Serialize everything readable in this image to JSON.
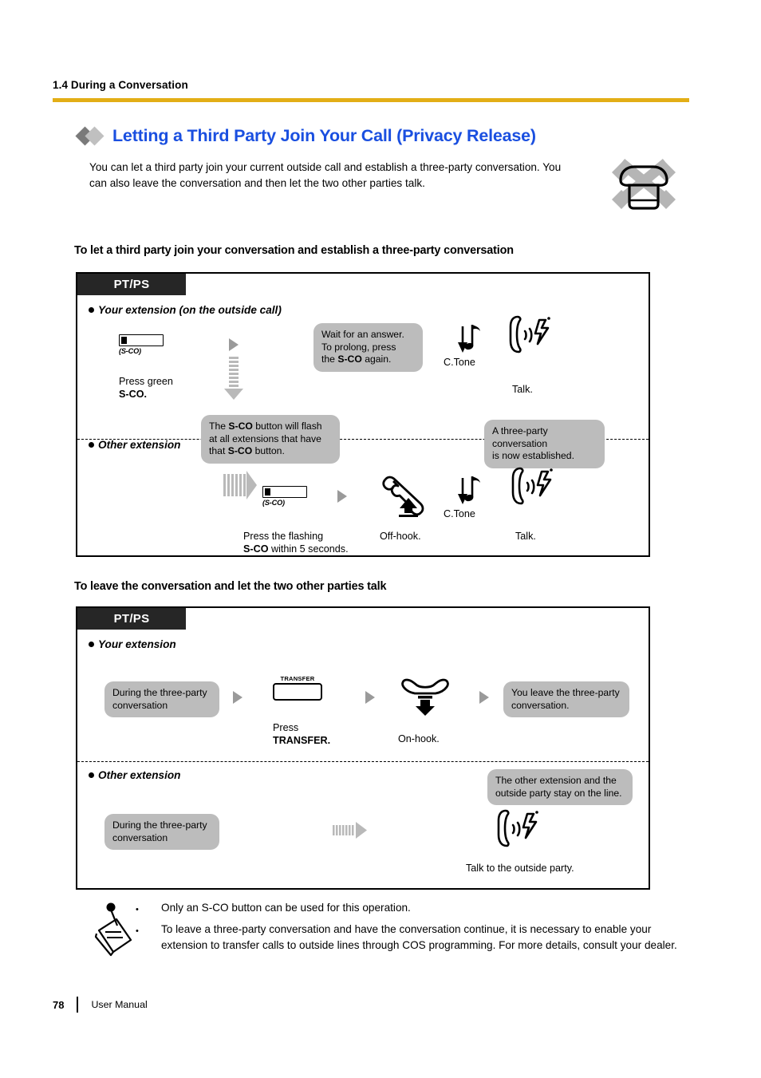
{
  "header": {
    "breadcrumb": "1.4 During a Conversation",
    "rule_color": "#e3ae16"
  },
  "title": {
    "text": "Letting a Third Party Join Your Call (Privacy Release)",
    "color": "#1a4fe0",
    "bullet_icons": [
      "diamond-dark-icon",
      "diamond-light-icon"
    ]
  },
  "intro": "You can let a third party join your current outside call and establish a three-party conversation. You can also leave the conversation and then let the two other parties talk.",
  "availability_icon": "single-line-telephone-not-available-icon",
  "section1": {
    "heading": "To let a third party join your conversation and establish a three-party conversation",
    "device_tag": "PT/PS",
    "row1": {
      "label": "Your extension (on the outside call)",
      "sco_button_label": "(S-CO)",
      "press_caption_line1": "Press green",
      "press_caption_line2": "S-CO.",
      "bubble_wait": "Wait for an answer. To prolong, press the S-CO again.",
      "bubble_wait_l1": "Wait for an answer.",
      "bubble_wait_l2": "To prolong, press",
      "bubble_wait_l3a": "the ",
      "bubble_wait_l3b": "S-CO",
      "bubble_wait_l3c": " again.",
      "ctone_label": "C.Tone",
      "talk_label": "Talk."
    },
    "bubble_flash_l1a": "The ",
    "bubble_flash_l1b": "S-CO",
    "bubble_flash_l1c": " button will flash",
    "bubble_flash_l2": "at all extensions that have",
    "bubble_flash_l3a": "that ",
    "bubble_flash_l3b": "S-CO",
    "bubble_flash_l3c": " button.",
    "bubble_established_l1": "A three-party conversation",
    "bubble_established_l2": "is now established.",
    "row2": {
      "label": "Other extension",
      "sco_button_label": "(S-CO)",
      "press_caption_line1": "Press the flashing",
      "press_caption_line2a": "S-CO",
      "press_caption_line2b": " within 5 seconds.",
      "offhook_label": "Off-hook.",
      "ctone_label": "C.Tone",
      "talk_label": "Talk."
    }
  },
  "section2": {
    "heading": "To leave the conversation and let the two other parties talk",
    "device_tag": "PT/PS",
    "row1": {
      "label": "Your extension",
      "bubble_during_l1": "During the three-party",
      "bubble_during_l2": "conversation",
      "transfer_button_label": "TRANSFER",
      "press_caption_line1": "Press",
      "press_caption_line2": "TRANSFER.",
      "onhook_label": "On-hook.",
      "bubble_leave_l1": "You leave the three-party",
      "bubble_leave_l2": "conversation."
    },
    "row2": {
      "label": "Other extension",
      "bubble_during_l1": "During the three-party",
      "bubble_during_l2": "conversation",
      "bubble_stay_l1": "The other extension and the",
      "bubble_stay_l2": "outside party stay on the line.",
      "talk_caption": "Talk to the outside party."
    }
  },
  "notes": {
    "icon": "note-pen-icon",
    "bullet": "•",
    "items": [
      "Only an S-CO button can be used for this operation.",
      "To leave a three-party conversation and have the conversation continue, it is necessary to enable your extension to transfer calls to outside lines through COS programming. For more details, consult your dealer."
    ]
  },
  "footer": {
    "page_number": "78",
    "label": "User Manual"
  }
}
